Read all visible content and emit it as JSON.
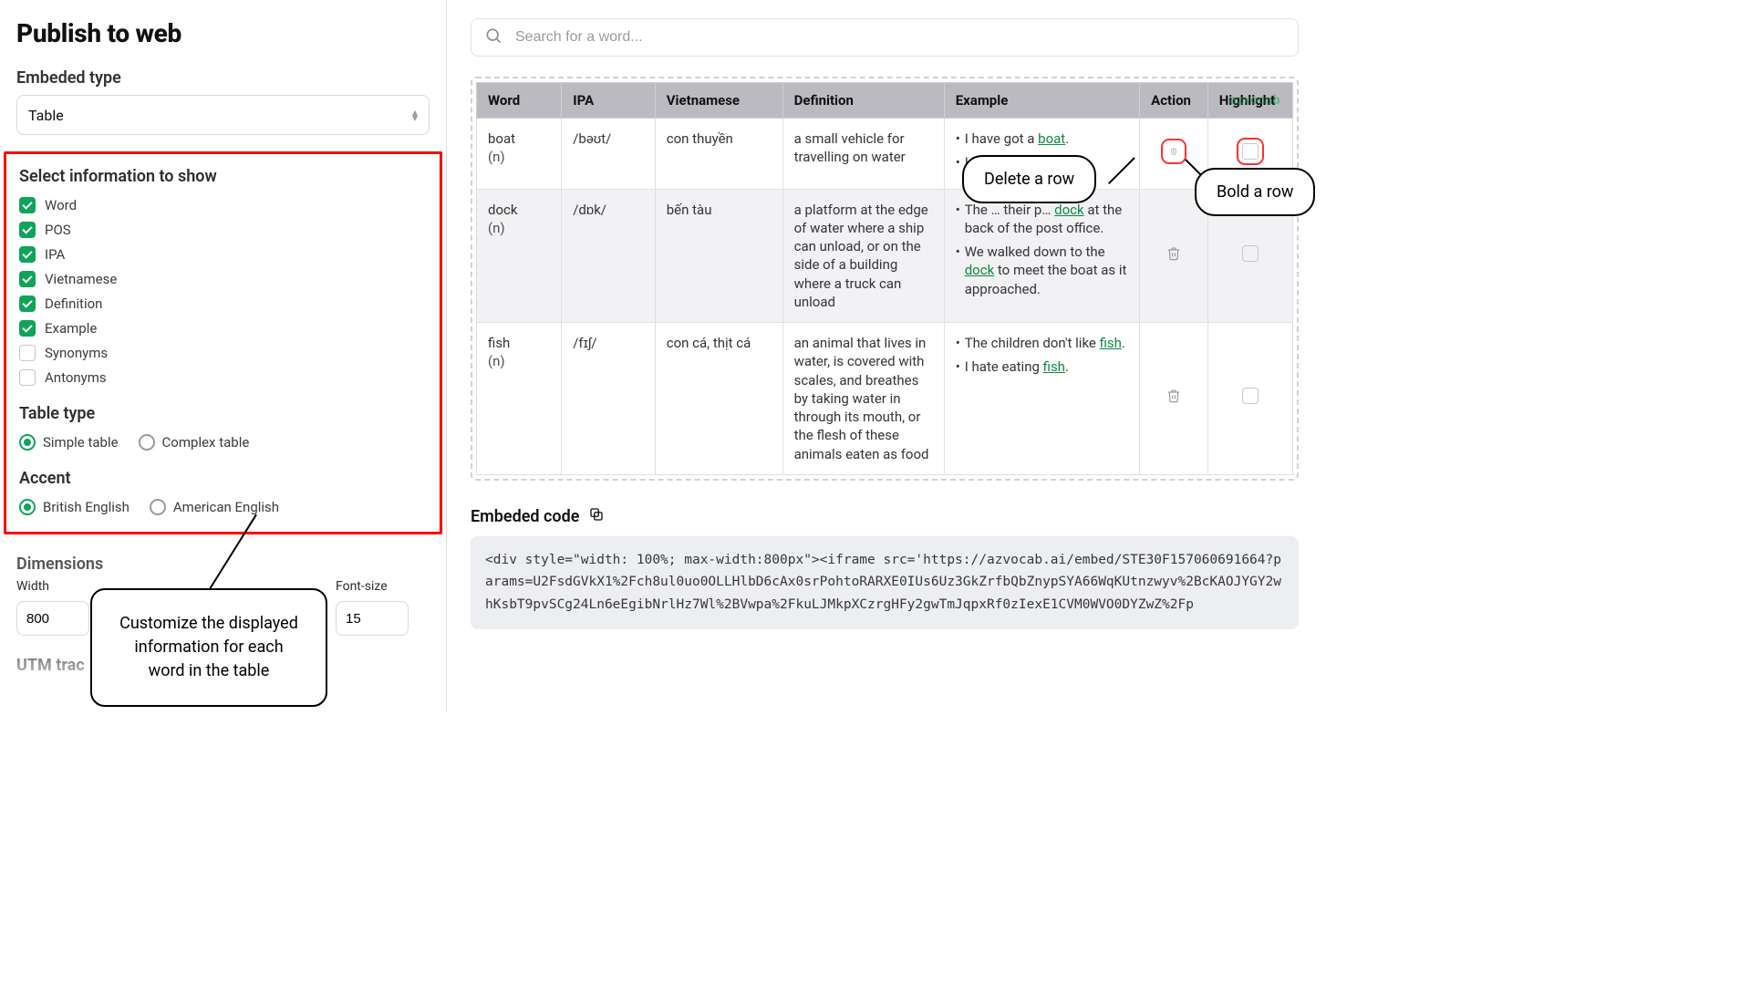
{
  "page_title": "Publish to web",
  "embed_type": {
    "label": "Embeded type",
    "value": "Table"
  },
  "info_section": {
    "heading": "Select information to show",
    "options": [
      {
        "key": "word",
        "label": "Word",
        "checked": true
      },
      {
        "key": "pos",
        "label": "POS",
        "checked": true
      },
      {
        "key": "ipa",
        "label": "IPA",
        "checked": true
      },
      {
        "key": "vietnamese",
        "label": "Vietnamese",
        "checked": true
      },
      {
        "key": "definition",
        "label": "Definition",
        "checked": true
      },
      {
        "key": "example",
        "label": "Example",
        "checked": true
      },
      {
        "key": "synonyms",
        "label": "Synonyms",
        "checked": false
      },
      {
        "key": "antonyms",
        "label": "Antonyms",
        "checked": false
      }
    ]
  },
  "table_type": {
    "heading": "Table type",
    "options": [
      {
        "label": "Simple table",
        "selected": true
      },
      {
        "label": "Complex table",
        "selected": false
      }
    ]
  },
  "accent": {
    "heading": "Accent",
    "options": [
      {
        "label": "British English",
        "selected": true
      },
      {
        "label": "American English",
        "selected": false
      }
    ]
  },
  "dimensions": {
    "heading": "Dimensions",
    "width_label": "Width",
    "width_value": "800",
    "fontsize_label": "Font-size",
    "fontsize_value": "15"
  },
  "utm_label": "UTM trac",
  "search": {
    "placeholder": "Search for a word..."
  },
  "watermark": "azvocab",
  "table": {
    "headers": [
      "Word",
      "IPA",
      "Vietnamese",
      "Definition",
      "Example",
      "Action",
      "Highlight"
    ],
    "rows": [
      {
        "word": "boat",
        "pos": "(n)",
        "ipa": "/bəʊt/",
        "vn": "con thuyền",
        "def": "a small vehicle for travelling on water",
        "examples": [
          {
            "pre": "I have got a ",
            "link": "boat",
            "post": "."
          },
          {
            "pre": "I hav… ",
            "link": "boa",
            "post": ""
          }
        ],
        "outline_action": true
      },
      {
        "word": "dock",
        "pos": "(n)",
        "ipa": "/dɒk/",
        "vn": "bến tàu",
        "def": "a platform at the edge of water where a ship can unload, or on the side of a building where a truck can unload",
        "examples": [
          {
            "pre": "The … their p… ",
            "link": "dock",
            "post": " at the back of the post office."
          },
          {
            "pre": "We walked down to the ",
            "link": "dock",
            "post": " to meet the boat as it approached."
          }
        ],
        "outline_action": false
      },
      {
        "word": "fish",
        "pos": "(n)",
        "ipa": "/fɪʃ/",
        "vn": "con cá, thịt cá",
        "def": "an animal that lives in water, is covered with scales, and breathes by taking water in through its mouth, or the flesh of these animals eaten as food",
        "examples": [
          {
            "pre": "The children don't like ",
            "link": "fish",
            "post": "."
          },
          {
            "pre": "I hate eating ",
            "link": "fish",
            "post": "."
          }
        ],
        "outline_action": false
      }
    ]
  },
  "code": {
    "heading": "Embeded code",
    "text": "<div style=\"width: 100%; max-width:800px\"><iframe src='https://azvocab.ai/embed/STE30F157060691664?params=U2FsdGVkX1%2Fch8ul0uo0OLLHlbD6cAx0srPohtoRARXE0IUs6Uz3GkZrfbQbZnypSYA66WqKUtnzwyv%2BcKAOJYGY2whKsbT9pvSCg24Ln6eEgibNrlHz7Wl%2BVwpa%2FkuLJMkpXCzrgHFy2gwTmJqpxRf0zIexE1CVM0WVO0DYZwZ%2Fp"
  },
  "callouts": {
    "delete": "Delete a row",
    "bold": "Bold a row",
    "customize": "Customize the displayed information for each word in the table"
  }
}
